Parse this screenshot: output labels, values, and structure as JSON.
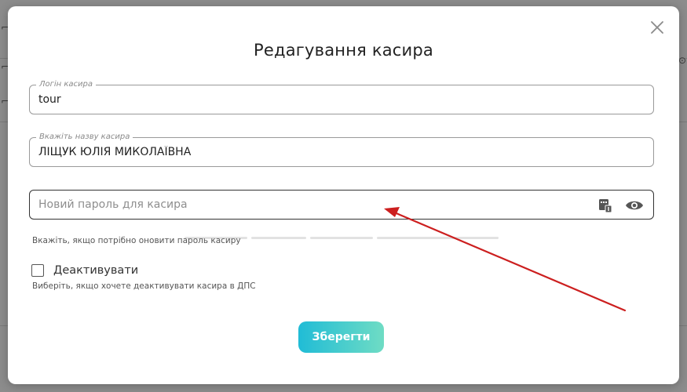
{
  "modal": {
    "title": "Редагування касира",
    "close_icon": "close-icon"
  },
  "login_field": {
    "label": "Логін касира",
    "value": "tour"
  },
  "name_field": {
    "label": "Вкажіть назву касира",
    "value": "ЛІЩУК ЮЛІЯ МИКОЛАЇВНА"
  },
  "password_field": {
    "placeholder": "Новий пароль для касира",
    "generate_icon": "password-generate-icon",
    "visibility_icon": "eye-icon",
    "hint": "Вкажіть, якщо потрібно оновити пароль касиру"
  },
  "deactivate": {
    "label": "Деактивувати",
    "checked": false,
    "hint": "Виберіть, якщо хочете деактивувати касира в ДПС"
  },
  "save_button": {
    "label": "Зберегти"
  },
  "colors": {
    "accent_start": "#20bcd6",
    "accent_end": "#6fdcc4",
    "annotation_arrow": "#cc1f1f"
  }
}
